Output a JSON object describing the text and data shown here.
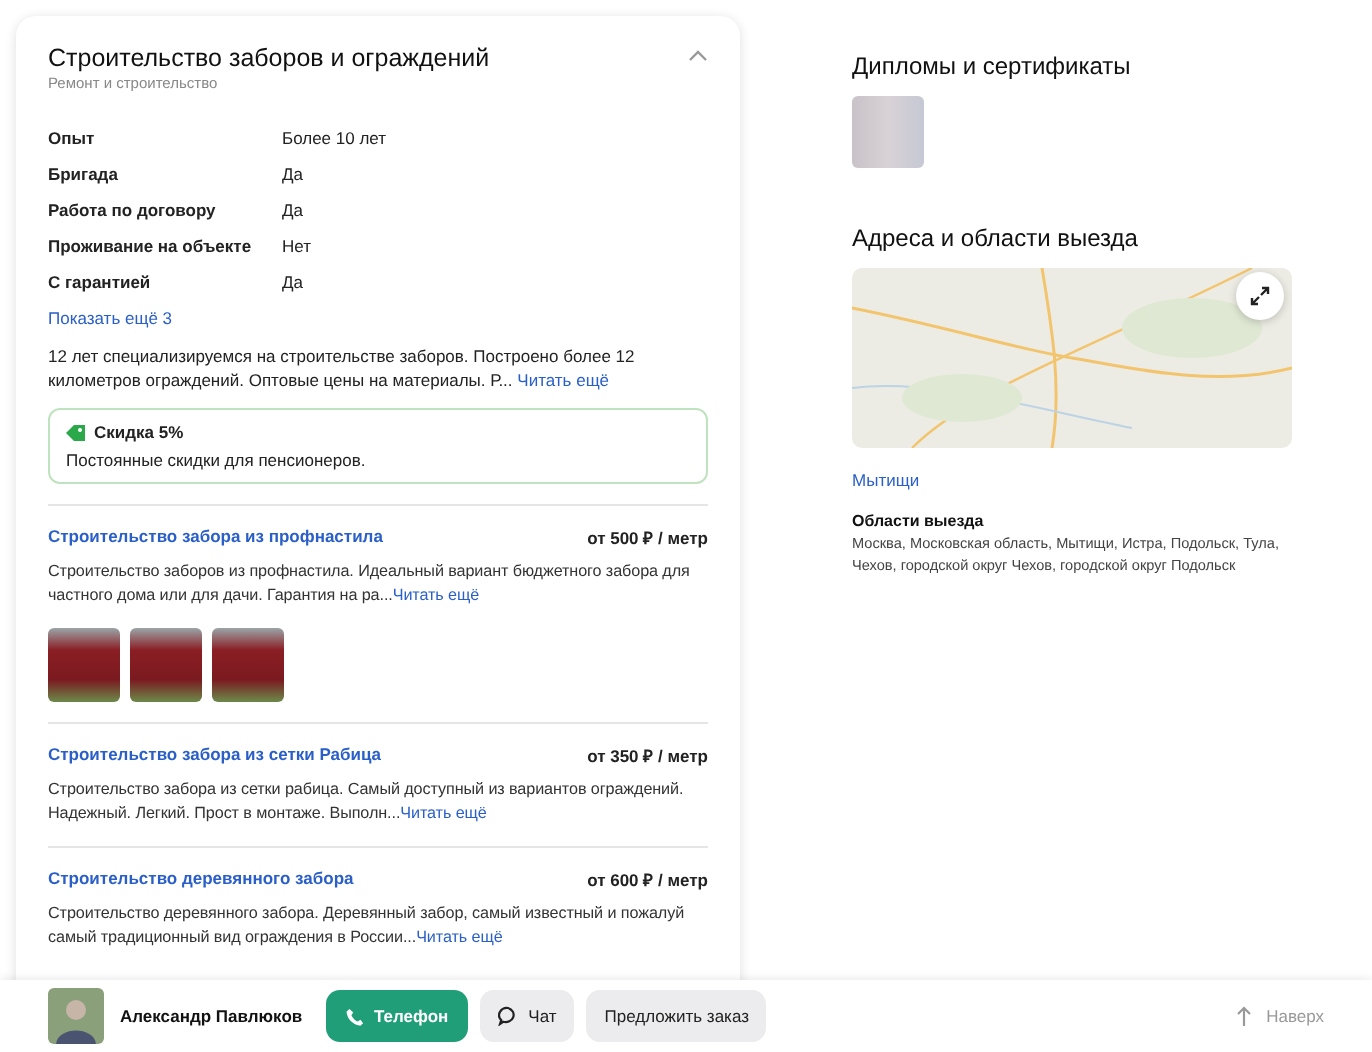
{
  "card": {
    "title": "Строительство заборов и ограждений",
    "subtitle": "Ремонт и строительство",
    "expanded": true,
    "attributes": [
      {
        "label": "Опыт",
        "value": "Более 10 лет"
      },
      {
        "label": "Бригада",
        "value": "Да"
      },
      {
        "label": "Работа по договору",
        "value": "Да"
      },
      {
        "label": "Проживание на объекте",
        "value": "Нет"
      },
      {
        "label": "С гарантией",
        "value": "Да"
      }
    ],
    "show_more": "Показать ещё 3",
    "description": "12 лет специализируемся на строительстве заборов. Построено более 12 километров ограждений. Оптовые цены на материалы. Р...",
    "read_more": "Читать ещё",
    "discount": {
      "title": "Скидка 5%",
      "text": "Постоянные скидки для пенсионеров."
    },
    "services": [
      {
        "name": "Строительство забора из профнастила",
        "price": "от 500 ₽ / метр",
        "description": "Строительство заборов из профнастила. Идеальный вариант бюджетного забора для частного дома или для дачи. Гарантия на ра...",
        "read_more": "Читать ещё",
        "photos": [
          {
            "kind": "photo"
          },
          {
            "kind": "photo"
          },
          {
            "kind": "photo"
          }
        ]
      },
      {
        "name": "Строительство забора из сетки Рабица",
        "price": "от 350 ₽ / метр",
        "description": "Строительство забора из сетки рабица. Самый доступный из вариантов ограждений. Надежный. Легкий. Прост в монтаже. Выполн...",
        "read_more": "Читать ещё"
      },
      {
        "name": "Строительство деревянного забора",
        "price": "от 600 ₽ / метр",
        "description": "Строительство деревянного забора. Деревянный забор, самый известный и пожалуй самый традиционный вид ограждения в России...",
        "read_more": "Читать ещё"
      }
    ]
  },
  "sidebar": {
    "certificates_title": "Дипломы и сертификаты",
    "addresses_title": "Адреса и области выезда",
    "address_link": "Мытищи",
    "areas_title": "Области выезда",
    "areas": "Москва, Московская область, Мытищи, Истра, Подольск, Тула, Чехов, городской округ Чехов, городской округ Подольск"
  },
  "bottom_bar": {
    "name": "Александр Павлюков",
    "phone": "Телефон",
    "chat": "Чат",
    "offer": "Предложить заказ",
    "to_top": "Наверх"
  }
}
